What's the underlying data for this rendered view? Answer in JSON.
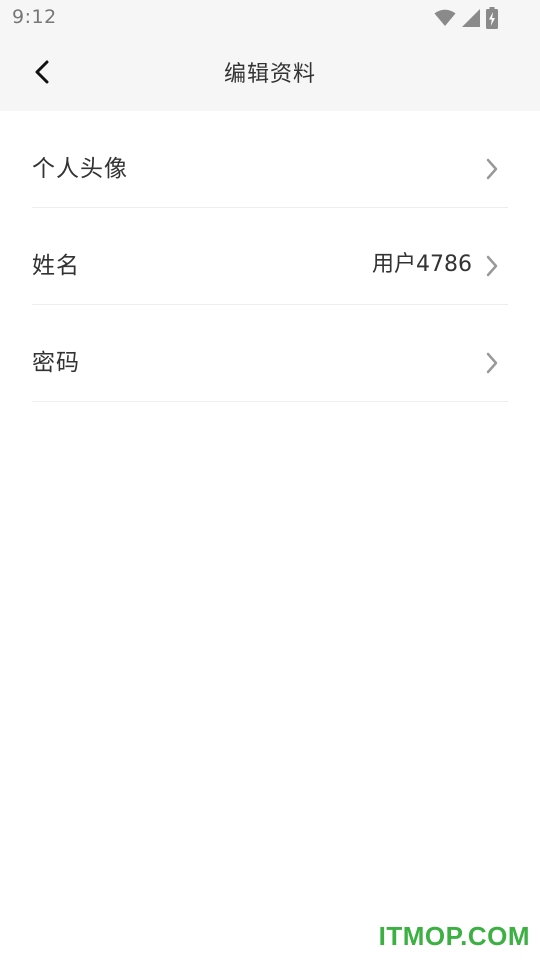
{
  "status_bar": {
    "time": "9:12",
    "icons": [
      "wifi-icon",
      "signal-icon",
      "battery-charging-icon"
    ]
  },
  "header": {
    "title": "编辑资料",
    "back_icon": "chevron-left-icon"
  },
  "rows": [
    {
      "label": "个人头像",
      "value": ""
    },
    {
      "label": "姓名",
      "value": "用户4786"
    },
    {
      "label": "密码",
      "value": ""
    }
  ],
  "watermark": "ITMOP.COM",
  "colors": {
    "header_bg": "#f6f6f6",
    "divider": "#eeeeee",
    "chevron": "#999999",
    "watermark": "#3cb043"
  }
}
